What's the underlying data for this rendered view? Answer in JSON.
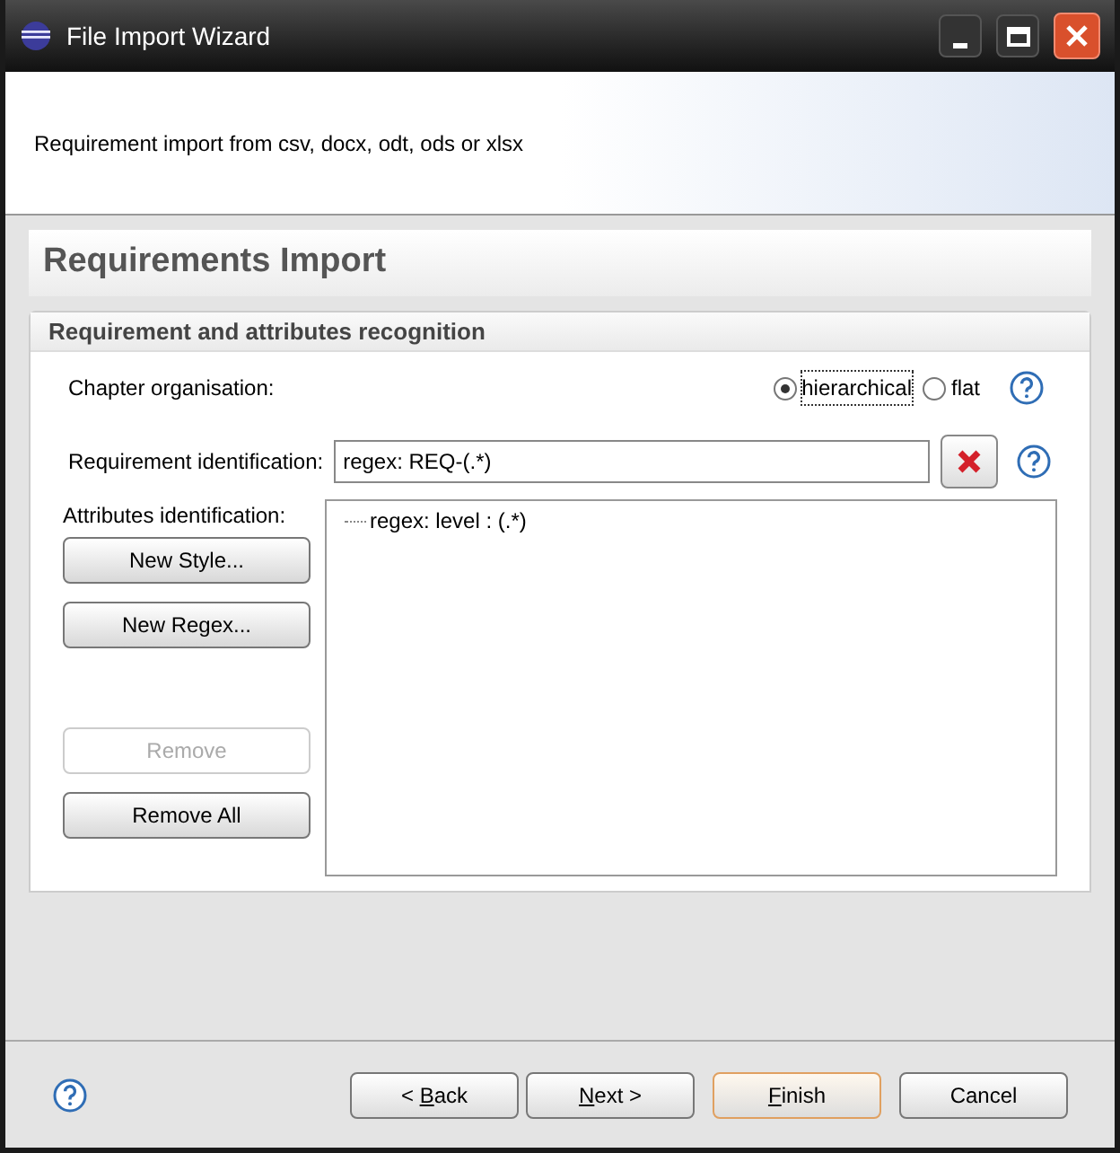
{
  "window": {
    "title": "File Import Wizard"
  },
  "description": "Requirement import from csv, docx, odt, ods or xlsx",
  "page_title": "Requirements Import",
  "group": {
    "title": "Requirement and attributes recognition",
    "chapter": {
      "label": "Chapter organisation:",
      "options": [
        {
          "label": "hierarchical",
          "selected": true,
          "focused": true
        },
        {
          "label": "flat",
          "selected": false,
          "focused": false
        }
      ]
    },
    "requirement": {
      "label": "Requirement identification:",
      "value": "regex: REQ-(.*)"
    },
    "attributes": {
      "label": "Attributes identification:",
      "buttons": [
        {
          "label": "New Style...",
          "disabled": false
        },
        {
          "label": "New Regex...",
          "disabled": false
        },
        {
          "label": "Remove",
          "disabled": true
        },
        {
          "label": "Remove All",
          "disabled": false
        }
      ],
      "tree": [
        {
          "label": "regex: level : (.*)"
        }
      ]
    }
  },
  "buttons": [
    {
      "before": "< ",
      "hotkey": "B",
      "after": "ack",
      "default": false
    },
    {
      "hotkey": "N",
      "after": "ext >",
      "default": false
    },
    {
      "hotkey": "F",
      "after": "inish",
      "default": true
    },
    {
      "after": "Cancel",
      "default": false
    }
  ]
}
